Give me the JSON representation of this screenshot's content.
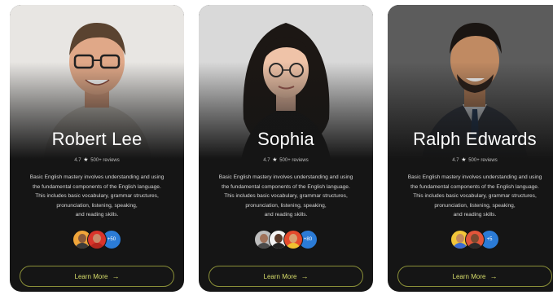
{
  "accent_color": "#d7dd6a",
  "cards": [
    {
      "name": "Robert Lee",
      "rating": "4.7",
      "reviews": "500+ reviews",
      "description": [
        "Basic English mastery involves understanding and using",
        "the fundamental components of the English language.",
        "This includes basic vocabulary, grammar structures,",
        "pronunciation, listening, speaking,",
        "and reading skills."
      ],
      "avatar_count": "+50",
      "avatar_count_color": "#2b7bd6",
      "button_label": "Learn More",
      "button_icon": "arrow-right-icon"
    },
    {
      "name": "Sophia",
      "rating": "4.7",
      "reviews": "500+ reviews",
      "description": [
        "Basic English mastery involves understanding and using",
        "the fundamental components of the English language.",
        "This includes basic vocabulary, grammar structures,",
        "pronunciation, listening, speaking,",
        "and reading skills."
      ],
      "avatar_count": "+80",
      "avatar_count_color": "#2b7bd6",
      "button_label": "Learn More",
      "button_icon": "arrow-right-icon"
    },
    {
      "name": "Ralph Edwards",
      "rating": "4.7",
      "reviews": "500+ reviews",
      "description": [
        "Basic English mastery involves understanding and using",
        "the fundamental components of the English language.",
        "This includes basic vocabulary, grammar structures,",
        "pronunciation, listening, speaking,",
        "and reading skills."
      ],
      "avatar_count": "+5",
      "avatar_count_color": "#2b7bd6",
      "button_label": "Learn More",
      "button_icon": "arrow-right-icon"
    }
  ]
}
